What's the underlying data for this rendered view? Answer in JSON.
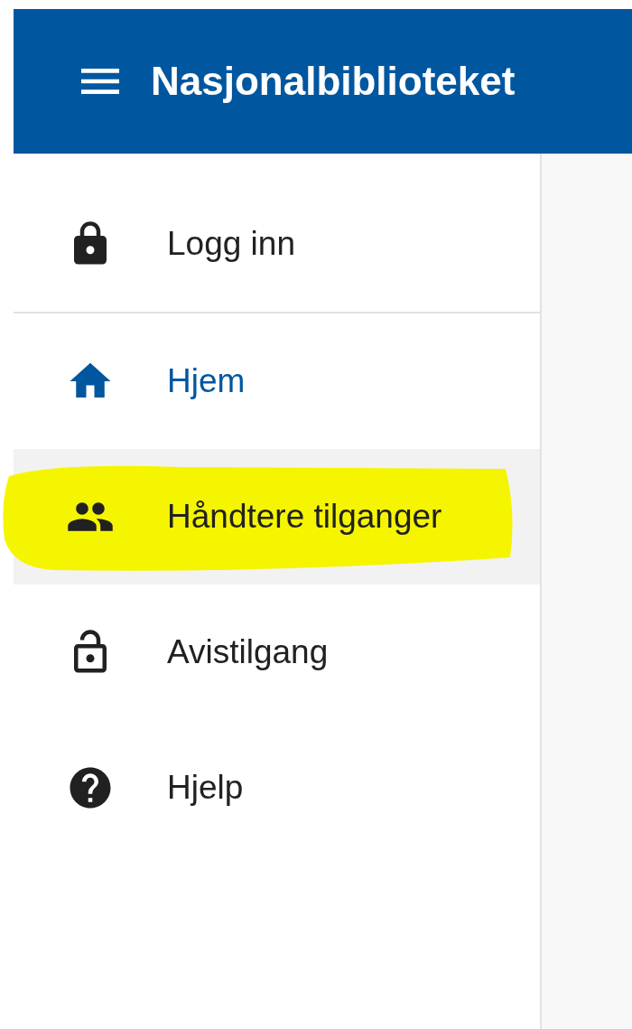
{
  "header": {
    "title": "Nasjonalbiblioteket"
  },
  "sidebar": {
    "account_item": {
      "label": "Logg inn"
    },
    "items": [
      {
        "label": "Hjem",
        "selected": true,
        "hovered": false,
        "highlighted": false
      },
      {
        "label": "Håndtere tilganger",
        "selected": false,
        "hovered": true,
        "highlighted": true
      },
      {
        "label": "Avistilgang",
        "selected": false,
        "hovered": false,
        "highlighted": false
      },
      {
        "label": "Hjelp",
        "selected": false,
        "hovered": false,
        "highlighted": false
      }
    ]
  }
}
